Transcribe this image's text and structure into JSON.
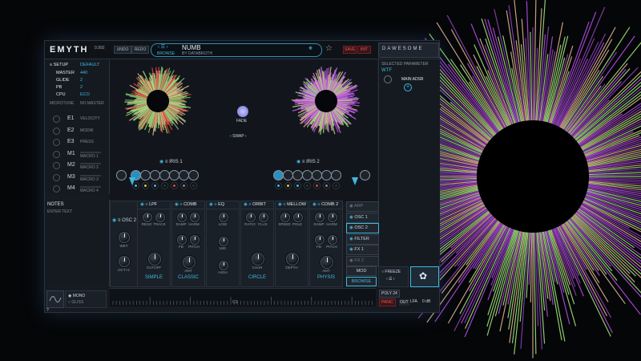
{
  "app": {
    "logo": "EMYTH",
    "version": "0.992",
    "undo": "UNDO",
    "redo": "REDO",
    "save": "SAVE",
    "init": "INIT",
    "brand": "DAWESOME"
  },
  "preset": {
    "name": "NUMB",
    "author": "BY DATABROTH",
    "browse": "BROWSE"
  },
  "setup": {
    "title": "SETUP",
    "default_label": "DEFAULT",
    "rows": [
      {
        "k": "MASTER",
        "v": "440"
      },
      {
        "k": "GLIDE",
        "v": "2"
      },
      {
        "k": "PB",
        "v": "2"
      },
      {
        "k": "CPU",
        "v": "ECO"
      }
    ],
    "microtune": "MICROTUNE",
    "no_master": "NO MASTER"
  },
  "mods": [
    {
      "id": "E1",
      "name": "VELOCITY"
    },
    {
      "id": "E2",
      "name": "MODW"
    },
    {
      "id": "E3",
      "name": "PRESS"
    },
    {
      "id": "M1",
      "name": "MACRO 1"
    },
    {
      "id": "M2",
      "name": "MACRO 2"
    },
    {
      "id": "M3",
      "name": "MACRO 3"
    },
    {
      "id": "M4",
      "name": "MACRO 4"
    }
  ],
  "notes": {
    "title": "NOTES",
    "placeholder": "ENTER TEXT"
  },
  "mono": "MONO",
  "gliss": "GLISS",
  "selected": {
    "title": "SELECTED PARAMETER",
    "name": "WTF",
    "adsr": "MAIN ADSR"
  },
  "iris": {
    "left": "IRIS 1",
    "right": "IRIS 2",
    "fade": "FADE",
    "swap": "SWAP"
  },
  "osc": {
    "title": "OSC 2",
    "wet": "WET",
    "oct": "OCT+2"
  },
  "fx": [
    {
      "title": "LPF",
      "labels": [
        "RESO",
        "TRACK",
        "CUTOFF"
      ],
      "mode": "SIMPLE"
    },
    {
      "title": "COMB",
      "labels": [
        "DAMP",
        "HARM",
        "FB",
        "PITCH",
        "AMT"
      ],
      "mode": "CLASSIC"
    },
    {
      "title": "EQ",
      "labels": [
        "LOW",
        "MID",
        "HIGH"
      ],
      "mode": ""
    },
    {
      "title": "ORBIT",
      "labels": [
        "RATIO",
        "FLUX",
        "CHAR"
      ],
      "mode": "CIRCLE"
    },
    {
      "title": "MELLOW",
      "labels": [
        "SPEED",
        "POLE",
        "DEPTH"
      ],
      "mode": ""
    },
    {
      "title": "COMB 2",
      "labels": [
        "DAMP",
        "HARM",
        "FB",
        "PITCH",
        "AMT"
      ],
      "mode": "PHYSIS"
    }
  ],
  "side_tabs": [
    "ARP",
    "OSC 1",
    "OSC 2",
    "FILTER",
    "FX 1",
    "FX 2"
  ],
  "bottom": {
    "mod": "MOD",
    "browse": "BROWSE",
    "freeze": "FREEZE",
    "poly": "POLY 24",
    "panic": "PANIC",
    "out": "OUT",
    "lfa": "LFA",
    "db": "0 dB",
    "c3": "C3",
    "help": "?"
  },
  "colors": {
    "accent": "#3fb8e0",
    "green": "#9ee07a",
    "purple": "#b24be0",
    "red": "#e0453f"
  }
}
